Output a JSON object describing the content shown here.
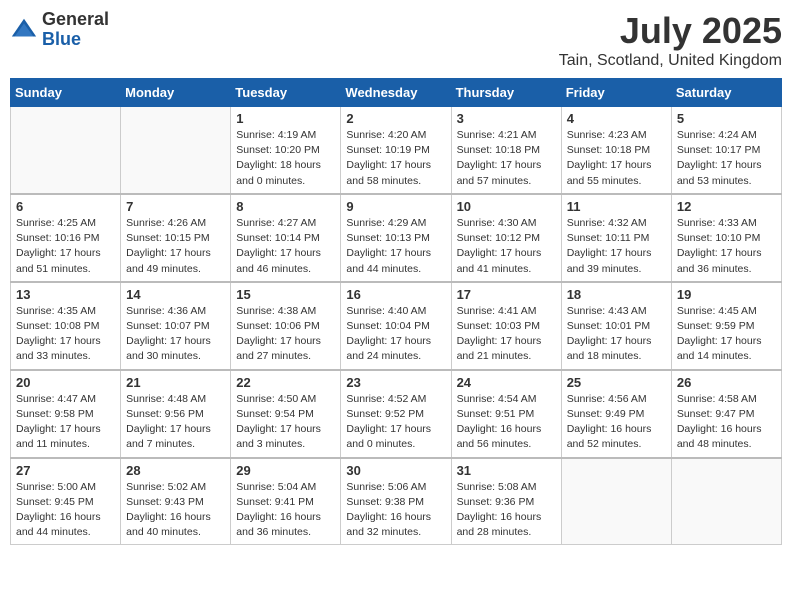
{
  "logo": {
    "general": "General",
    "blue": "Blue"
  },
  "title": {
    "month_year": "July 2025",
    "location": "Tain, Scotland, United Kingdom"
  },
  "headers": [
    "Sunday",
    "Monday",
    "Tuesday",
    "Wednesday",
    "Thursday",
    "Friday",
    "Saturday"
  ],
  "weeks": [
    [
      {
        "day": "",
        "info": ""
      },
      {
        "day": "",
        "info": ""
      },
      {
        "day": "1",
        "info": "Sunrise: 4:19 AM\nSunset: 10:20 PM\nDaylight: 18 hours\nand 0 minutes."
      },
      {
        "day": "2",
        "info": "Sunrise: 4:20 AM\nSunset: 10:19 PM\nDaylight: 17 hours\nand 58 minutes."
      },
      {
        "day": "3",
        "info": "Sunrise: 4:21 AM\nSunset: 10:18 PM\nDaylight: 17 hours\nand 57 minutes."
      },
      {
        "day": "4",
        "info": "Sunrise: 4:23 AM\nSunset: 10:18 PM\nDaylight: 17 hours\nand 55 minutes."
      },
      {
        "day": "5",
        "info": "Sunrise: 4:24 AM\nSunset: 10:17 PM\nDaylight: 17 hours\nand 53 minutes."
      }
    ],
    [
      {
        "day": "6",
        "info": "Sunrise: 4:25 AM\nSunset: 10:16 PM\nDaylight: 17 hours\nand 51 minutes."
      },
      {
        "day": "7",
        "info": "Sunrise: 4:26 AM\nSunset: 10:15 PM\nDaylight: 17 hours\nand 49 minutes."
      },
      {
        "day": "8",
        "info": "Sunrise: 4:27 AM\nSunset: 10:14 PM\nDaylight: 17 hours\nand 46 minutes."
      },
      {
        "day": "9",
        "info": "Sunrise: 4:29 AM\nSunset: 10:13 PM\nDaylight: 17 hours\nand 44 minutes."
      },
      {
        "day": "10",
        "info": "Sunrise: 4:30 AM\nSunset: 10:12 PM\nDaylight: 17 hours\nand 41 minutes."
      },
      {
        "day": "11",
        "info": "Sunrise: 4:32 AM\nSunset: 10:11 PM\nDaylight: 17 hours\nand 39 minutes."
      },
      {
        "day": "12",
        "info": "Sunrise: 4:33 AM\nSunset: 10:10 PM\nDaylight: 17 hours\nand 36 minutes."
      }
    ],
    [
      {
        "day": "13",
        "info": "Sunrise: 4:35 AM\nSunset: 10:08 PM\nDaylight: 17 hours\nand 33 minutes."
      },
      {
        "day": "14",
        "info": "Sunrise: 4:36 AM\nSunset: 10:07 PM\nDaylight: 17 hours\nand 30 minutes."
      },
      {
        "day": "15",
        "info": "Sunrise: 4:38 AM\nSunset: 10:06 PM\nDaylight: 17 hours\nand 27 minutes."
      },
      {
        "day": "16",
        "info": "Sunrise: 4:40 AM\nSunset: 10:04 PM\nDaylight: 17 hours\nand 24 minutes."
      },
      {
        "day": "17",
        "info": "Sunrise: 4:41 AM\nSunset: 10:03 PM\nDaylight: 17 hours\nand 21 minutes."
      },
      {
        "day": "18",
        "info": "Sunrise: 4:43 AM\nSunset: 10:01 PM\nDaylight: 17 hours\nand 18 minutes."
      },
      {
        "day": "19",
        "info": "Sunrise: 4:45 AM\nSunset: 9:59 PM\nDaylight: 17 hours\nand 14 minutes."
      }
    ],
    [
      {
        "day": "20",
        "info": "Sunrise: 4:47 AM\nSunset: 9:58 PM\nDaylight: 17 hours\nand 11 minutes."
      },
      {
        "day": "21",
        "info": "Sunrise: 4:48 AM\nSunset: 9:56 PM\nDaylight: 17 hours\nand 7 minutes."
      },
      {
        "day": "22",
        "info": "Sunrise: 4:50 AM\nSunset: 9:54 PM\nDaylight: 17 hours\nand 3 minutes."
      },
      {
        "day": "23",
        "info": "Sunrise: 4:52 AM\nSunset: 9:52 PM\nDaylight: 17 hours\nand 0 minutes."
      },
      {
        "day": "24",
        "info": "Sunrise: 4:54 AM\nSunset: 9:51 PM\nDaylight: 16 hours\nand 56 minutes."
      },
      {
        "day": "25",
        "info": "Sunrise: 4:56 AM\nSunset: 9:49 PM\nDaylight: 16 hours\nand 52 minutes."
      },
      {
        "day": "26",
        "info": "Sunrise: 4:58 AM\nSunset: 9:47 PM\nDaylight: 16 hours\nand 48 minutes."
      }
    ],
    [
      {
        "day": "27",
        "info": "Sunrise: 5:00 AM\nSunset: 9:45 PM\nDaylight: 16 hours\nand 44 minutes."
      },
      {
        "day": "28",
        "info": "Sunrise: 5:02 AM\nSunset: 9:43 PM\nDaylight: 16 hours\nand 40 minutes."
      },
      {
        "day": "29",
        "info": "Sunrise: 5:04 AM\nSunset: 9:41 PM\nDaylight: 16 hours\nand 36 minutes."
      },
      {
        "day": "30",
        "info": "Sunrise: 5:06 AM\nSunset: 9:38 PM\nDaylight: 16 hours\nand 32 minutes."
      },
      {
        "day": "31",
        "info": "Sunrise: 5:08 AM\nSunset: 9:36 PM\nDaylight: 16 hours\nand 28 minutes."
      },
      {
        "day": "",
        "info": ""
      },
      {
        "day": "",
        "info": ""
      }
    ]
  ]
}
